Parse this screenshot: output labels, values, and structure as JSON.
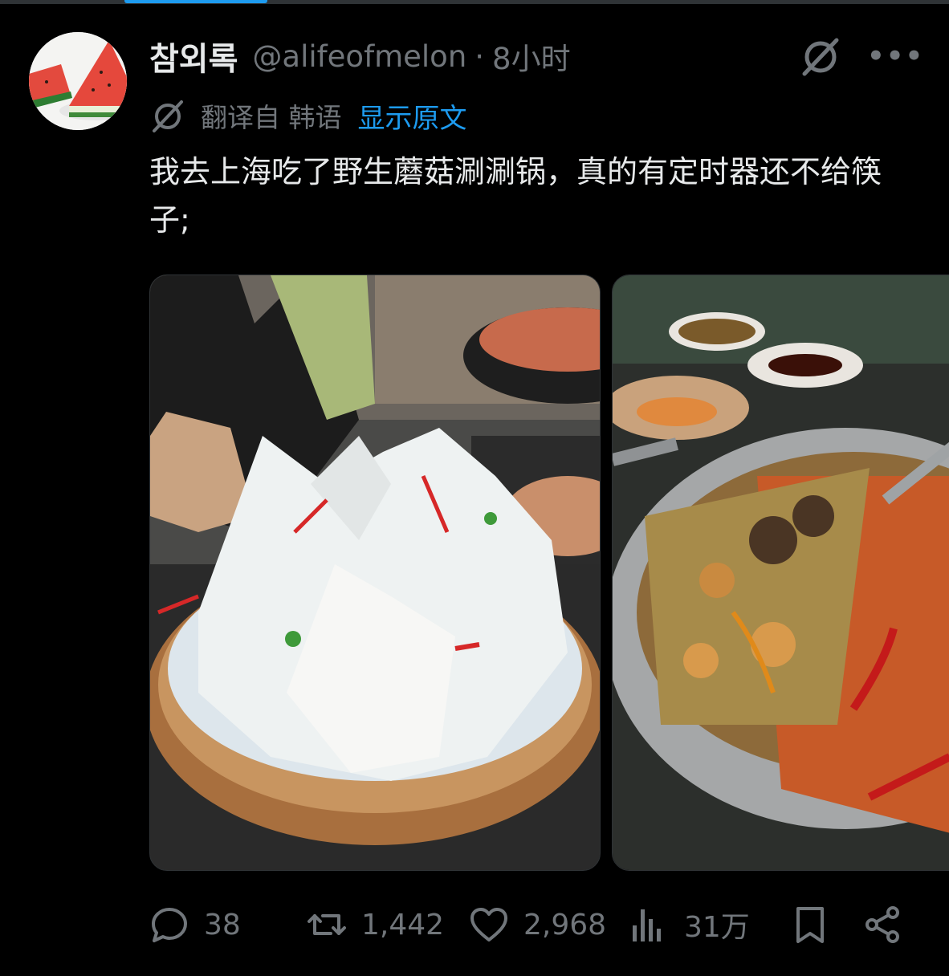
{
  "author": {
    "display_name": "참외록",
    "handle": "@alifeofmelon",
    "separator": "·",
    "time": "8小时"
  },
  "translation": {
    "label": "翻译自 韩语",
    "show_original": "显示原文"
  },
  "tweet": {
    "text": "我去上海吃了野生蘑菇涮涮锅，真的有定时器还不给筷子;"
  },
  "stats": {
    "replies": "38",
    "retweets": "1,442",
    "likes": "2,968",
    "views": "31万"
  },
  "icons": {
    "reply": "reply-bubble-icon",
    "retweet": "retweet-icon",
    "like": "heart-icon",
    "views": "views-bar-chart-icon",
    "bookmark": "bookmark-icon",
    "share": "share-icon",
    "grok": "grok-icon",
    "more": "more-dots-icon",
    "translate": "translate-icon"
  },
  "colors": {
    "background": "#000000",
    "text": "#e7e9ea",
    "secondary": "#71767b",
    "accent": "#1d9bf0"
  }
}
